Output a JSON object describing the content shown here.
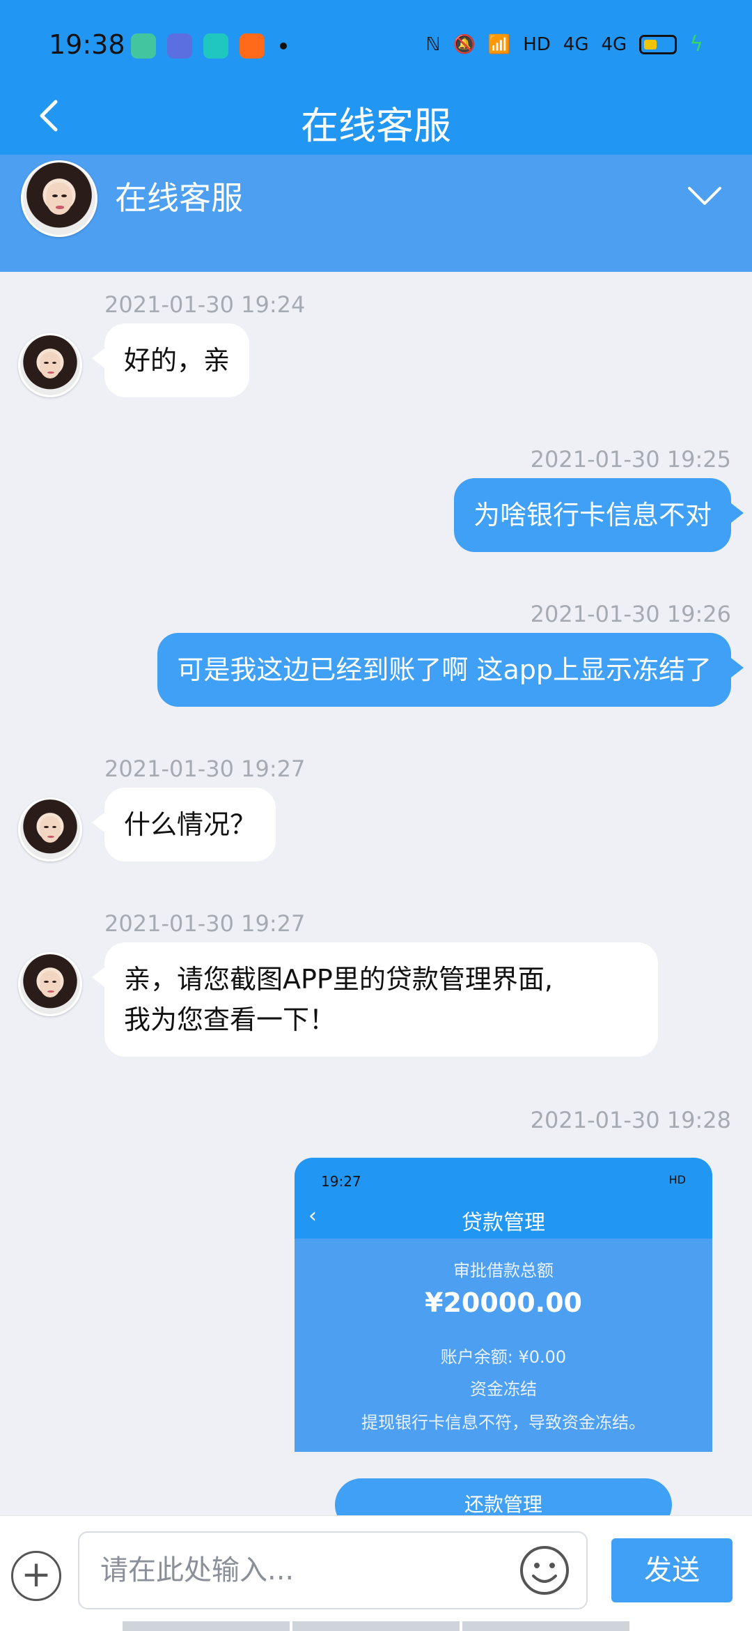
{
  "status_bar": {
    "time": "19:38",
    "right_text": "HD",
    "network_1": "4G",
    "network_2": "4G"
  },
  "header": {
    "title": "在线客服"
  },
  "agent": {
    "name": "在线客服"
  },
  "messages": [
    {
      "side": "in",
      "timestamp": "2021-01-30 19:24",
      "text": "好的，亲"
    },
    {
      "side": "out",
      "timestamp": "2021-01-30 19:25",
      "text": "为啥银行卡信息不对"
    },
    {
      "side": "out",
      "timestamp": "2021-01-30 19:26",
      "text": "可是我这边已经到账了啊 这app上显示冻结了"
    },
    {
      "side": "in",
      "timestamp": "2021-01-30 19:27",
      "text": "什么情况？"
    },
    {
      "side": "in",
      "timestamp": "2021-01-30 19:27",
      "text_line1": "亲，请您截图APP里的贷款管理界面,",
      "text_line2": "我为您查看一下！"
    },
    {
      "side": "out",
      "timestamp": "2021-01-30 19:28"
    }
  ],
  "screenshot": {
    "time": "19:27",
    "status_right": "HD",
    "title": "贷款管理",
    "label_total": "审批借款总额",
    "amount": "¥20000.00",
    "balance": "账户余额: ¥0.00",
    "status": "资金冻结",
    "reason": "提现银行卡信息不符，导致资金冻结。",
    "button": "还款管理"
  },
  "input": {
    "placeholder": "请在此处输入...",
    "send_label": "发送"
  },
  "colors": {
    "primary": "#2196f3",
    "panel": "#4d9ff2",
    "bubble_out": "#3fa0f5",
    "background": "#eef0f6"
  },
  "icons": [
    "back-icon",
    "chevron-down-icon",
    "plus-icon",
    "emoji-icon",
    "battery-icon",
    "charging-icon"
  ]
}
